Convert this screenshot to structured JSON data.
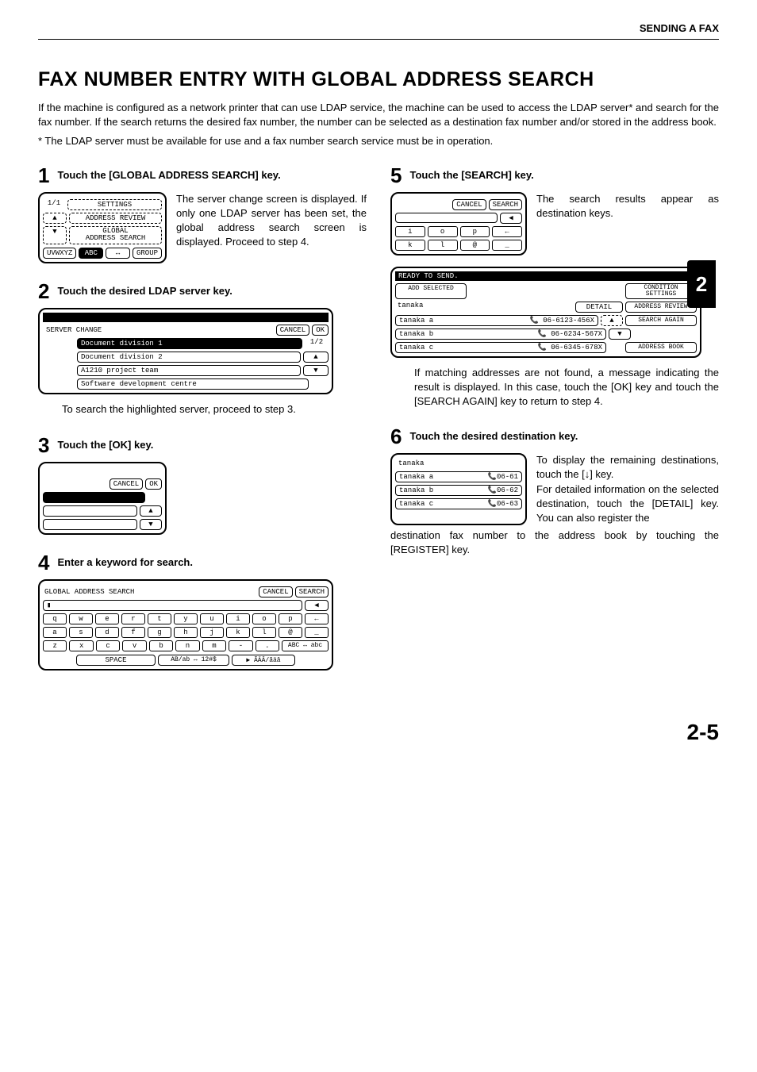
{
  "header": "SENDING A FAX",
  "title": "FAX NUMBER ENTRY WITH GLOBAL ADDRESS SEARCH",
  "intro": "If the machine is configured as a network printer that can use LDAP service, the machine can be used to access the LDAP server* and search for the fax number. If the search returns the desired fax number, the number can be selected as a destination fax number and/or stored in the address book.",
  "footnote": "* The LDAP server must be available for use and a fax number search service must be in operation.",
  "side_tab": "2",
  "page_number": "2-5",
  "steps": {
    "s1": {
      "num": "1",
      "title": "Touch the [GLOBAL ADDRESS SEARCH] key.",
      "desc": "The server change screen is displayed. If only one LDAP server has been set, the global address search screen is displayed. Proceed to step 4.",
      "panel": {
        "page": "1/1",
        "settings": "SETTINGS",
        "addr_review": "ADDRESS REVIEW",
        "global": "GLOBAL\nADDRESS SEARCH",
        "tab_left": "UVWXYZ",
        "tab_abc": "ABC",
        "tab_group": "GROUP"
      }
    },
    "s2": {
      "num": "2",
      "title": "Touch the desired LDAP server key.",
      "body_after": "To search the highlighted server, proceed to step 3.",
      "panel": {
        "label": "SERVER CHANGE",
        "cancel": "CANCEL",
        "ok": "OK",
        "page": "1/2",
        "rows": [
          "Document division 1",
          "Document division 2",
          "A1210 project team",
          "Software development centre"
        ]
      }
    },
    "s3": {
      "num": "3",
      "title": "Touch the [OK] key.",
      "panel": {
        "cancel": "CANCEL",
        "ok": "OK"
      }
    },
    "s4": {
      "num": "4",
      "title": "Enter a keyword for search.",
      "panel": {
        "header": "GLOBAL ADDRESS SEARCH",
        "cancel": "CANCEL",
        "search": "SEARCH",
        "row1": [
          "q",
          "w",
          "e",
          "r",
          "t",
          "y",
          "u",
          "i",
          "o",
          "p",
          "←"
        ],
        "row2": [
          "a",
          "s",
          "d",
          "f",
          "g",
          "h",
          "j",
          "k",
          "l",
          "@",
          "_"
        ],
        "row3": [
          "z",
          "x",
          "c",
          "v",
          "b",
          "n",
          "m",
          "-",
          ".",
          "ABC ↔ abc"
        ],
        "space": "SPACE",
        "mode1": "AB/ab ↔ 12#$",
        "mode2": "▶ ÃÄÂ/ãäâ"
      }
    },
    "s5": {
      "num": "5",
      "title": "Touch the [SEARCH] key.",
      "desc": "The search results appear as destination keys.",
      "panel_upper": {
        "cancel": "CANCEL",
        "search": "SEARCH",
        "row1": [
          "i",
          "o",
          "p",
          "←"
        ],
        "row2": [
          "k",
          "l",
          "@",
          "_"
        ]
      },
      "panel_lower": {
        "status": "READY TO SEND.",
        "add_selected": "ADD SELECTED",
        "cond": "CONDITION\nSETTINGS",
        "name": "tanaka",
        "detail": "DETAIL",
        "addr_review": "ADDRESS REVIEW",
        "search_again": "SEARCH AGAIN",
        "address_book": "ADDRESS BOOK",
        "rows": [
          {
            "n": "tanaka a",
            "f": "06-6123-456X"
          },
          {
            "n": "tanaka b",
            "f": "06-6234-567X"
          },
          {
            "n": "tanaka c",
            "f": "06-6345-678X"
          }
        ]
      },
      "body_after": "If matching addresses are not found, a message indicating the result is displayed. In this case, touch the [OK] key and touch the [SEARCH AGAIN] key to return to step 4."
    },
    "s6": {
      "num": "6",
      "title": "Touch the desired destination key.",
      "desc": "To display the remaining destinations, touch the [↓] key.\nFor detailed information on the selected destination, touch the [DETAIL] key. You can also register the",
      "body_after": "destination fax number to the address book by touching the [REGISTER] key.",
      "panel": {
        "name": "tanaka",
        "rows": [
          {
            "n": "tanaka a",
            "f": "06-61"
          },
          {
            "n": "tanaka b",
            "f": "06-62"
          },
          {
            "n": "tanaka c",
            "f": "06-63"
          }
        ]
      }
    }
  }
}
